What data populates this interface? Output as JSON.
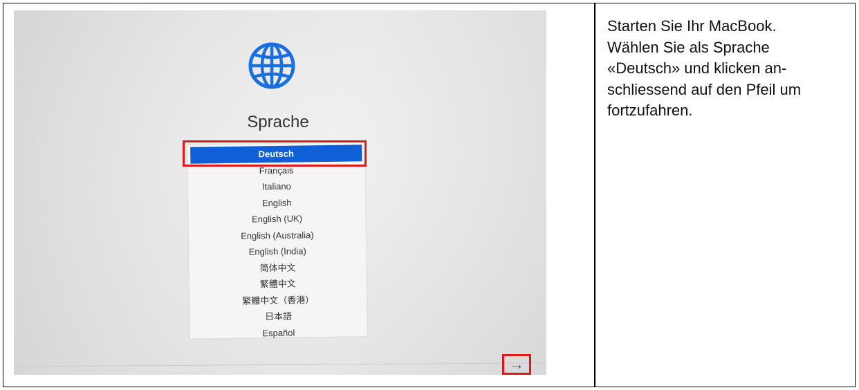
{
  "screen": {
    "title": "Sprache",
    "globe_icon": "globe-icon",
    "languages": [
      {
        "label": "Deutsch",
        "selected": true
      },
      {
        "label": "Français",
        "selected": false
      },
      {
        "label": "Italiano",
        "selected": false
      },
      {
        "label": "English",
        "selected": false
      },
      {
        "label": "English (UK)",
        "selected": false
      },
      {
        "label": "English (Australia)",
        "selected": false
      },
      {
        "label": "English (India)",
        "selected": false
      },
      {
        "label": "简体中文",
        "selected": false
      },
      {
        "label": "繁體中文",
        "selected": false
      },
      {
        "label": "繁體中文（香港）",
        "selected": false
      },
      {
        "label": "日本語",
        "selected": false
      },
      {
        "label": "Español",
        "selected": false
      }
    ],
    "next_arrow": "→",
    "accent_color": "#0f5fd6",
    "highlight_color": "#e01818"
  },
  "instructions": {
    "text": "Starten Sie Ihr MacBook.\nWählen Sie als Sprache «Deutsch» und klicken an-\nschliessend auf den Pfeil um fortzufahren."
  }
}
